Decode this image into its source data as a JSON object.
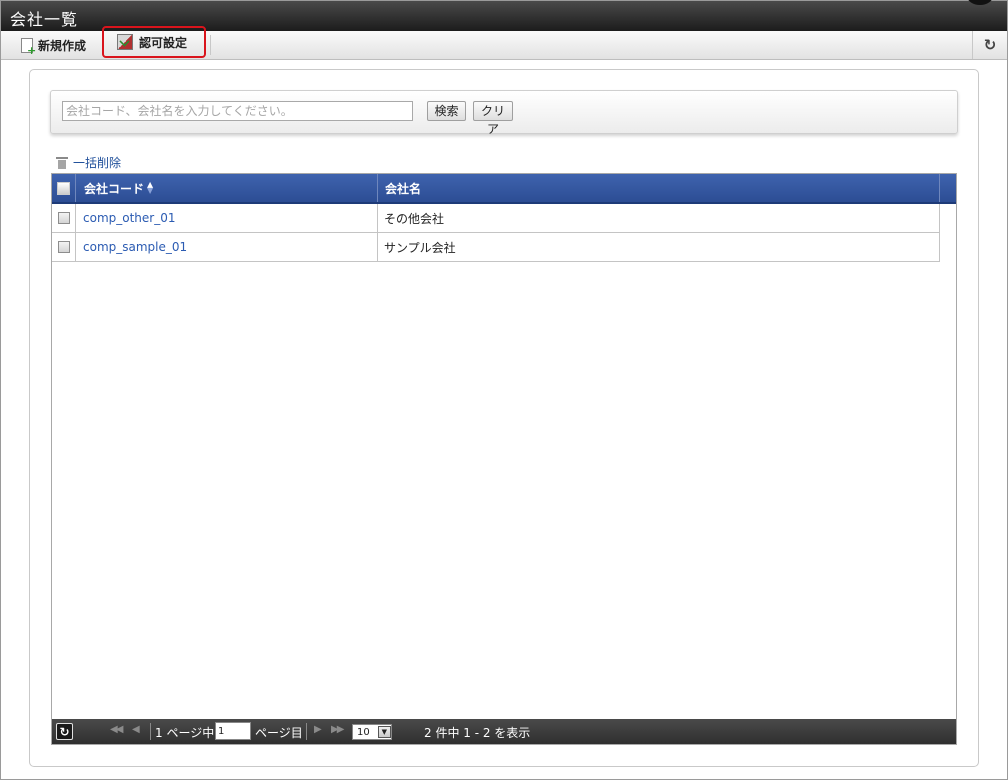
{
  "window": {
    "title": "会社一覧"
  },
  "toolbar": {
    "new_label": "新規作成",
    "new_icon": "new-document-icon",
    "permission_label": "認可設定",
    "permission_icon": "permission-settings-icon",
    "refresh_icon": "refresh-icon",
    "highlight_color": "#d9141c"
  },
  "search": {
    "placeholder": "会社コード、会社名を入力してください。",
    "value": "",
    "search_button": "検索",
    "clear_button": "クリア"
  },
  "bulk_delete": {
    "label": "一括削除",
    "icon": "trash-icon"
  },
  "table": {
    "header_color": "#2f519b",
    "columns": {
      "code": "会社コード",
      "name": "会社名"
    },
    "sort": "ascending",
    "rows": [
      {
        "code": "comp_other_01",
        "name": "その他会社"
      },
      {
        "code": "comp_sample_01",
        "name": "サンプル会社"
      }
    ]
  },
  "pager": {
    "page_prefix": "1 ページ中",
    "current_page": "1",
    "page_suffix": "ページ目",
    "page_size": "10",
    "summary": "2 件中 1 - 2 を表示"
  }
}
